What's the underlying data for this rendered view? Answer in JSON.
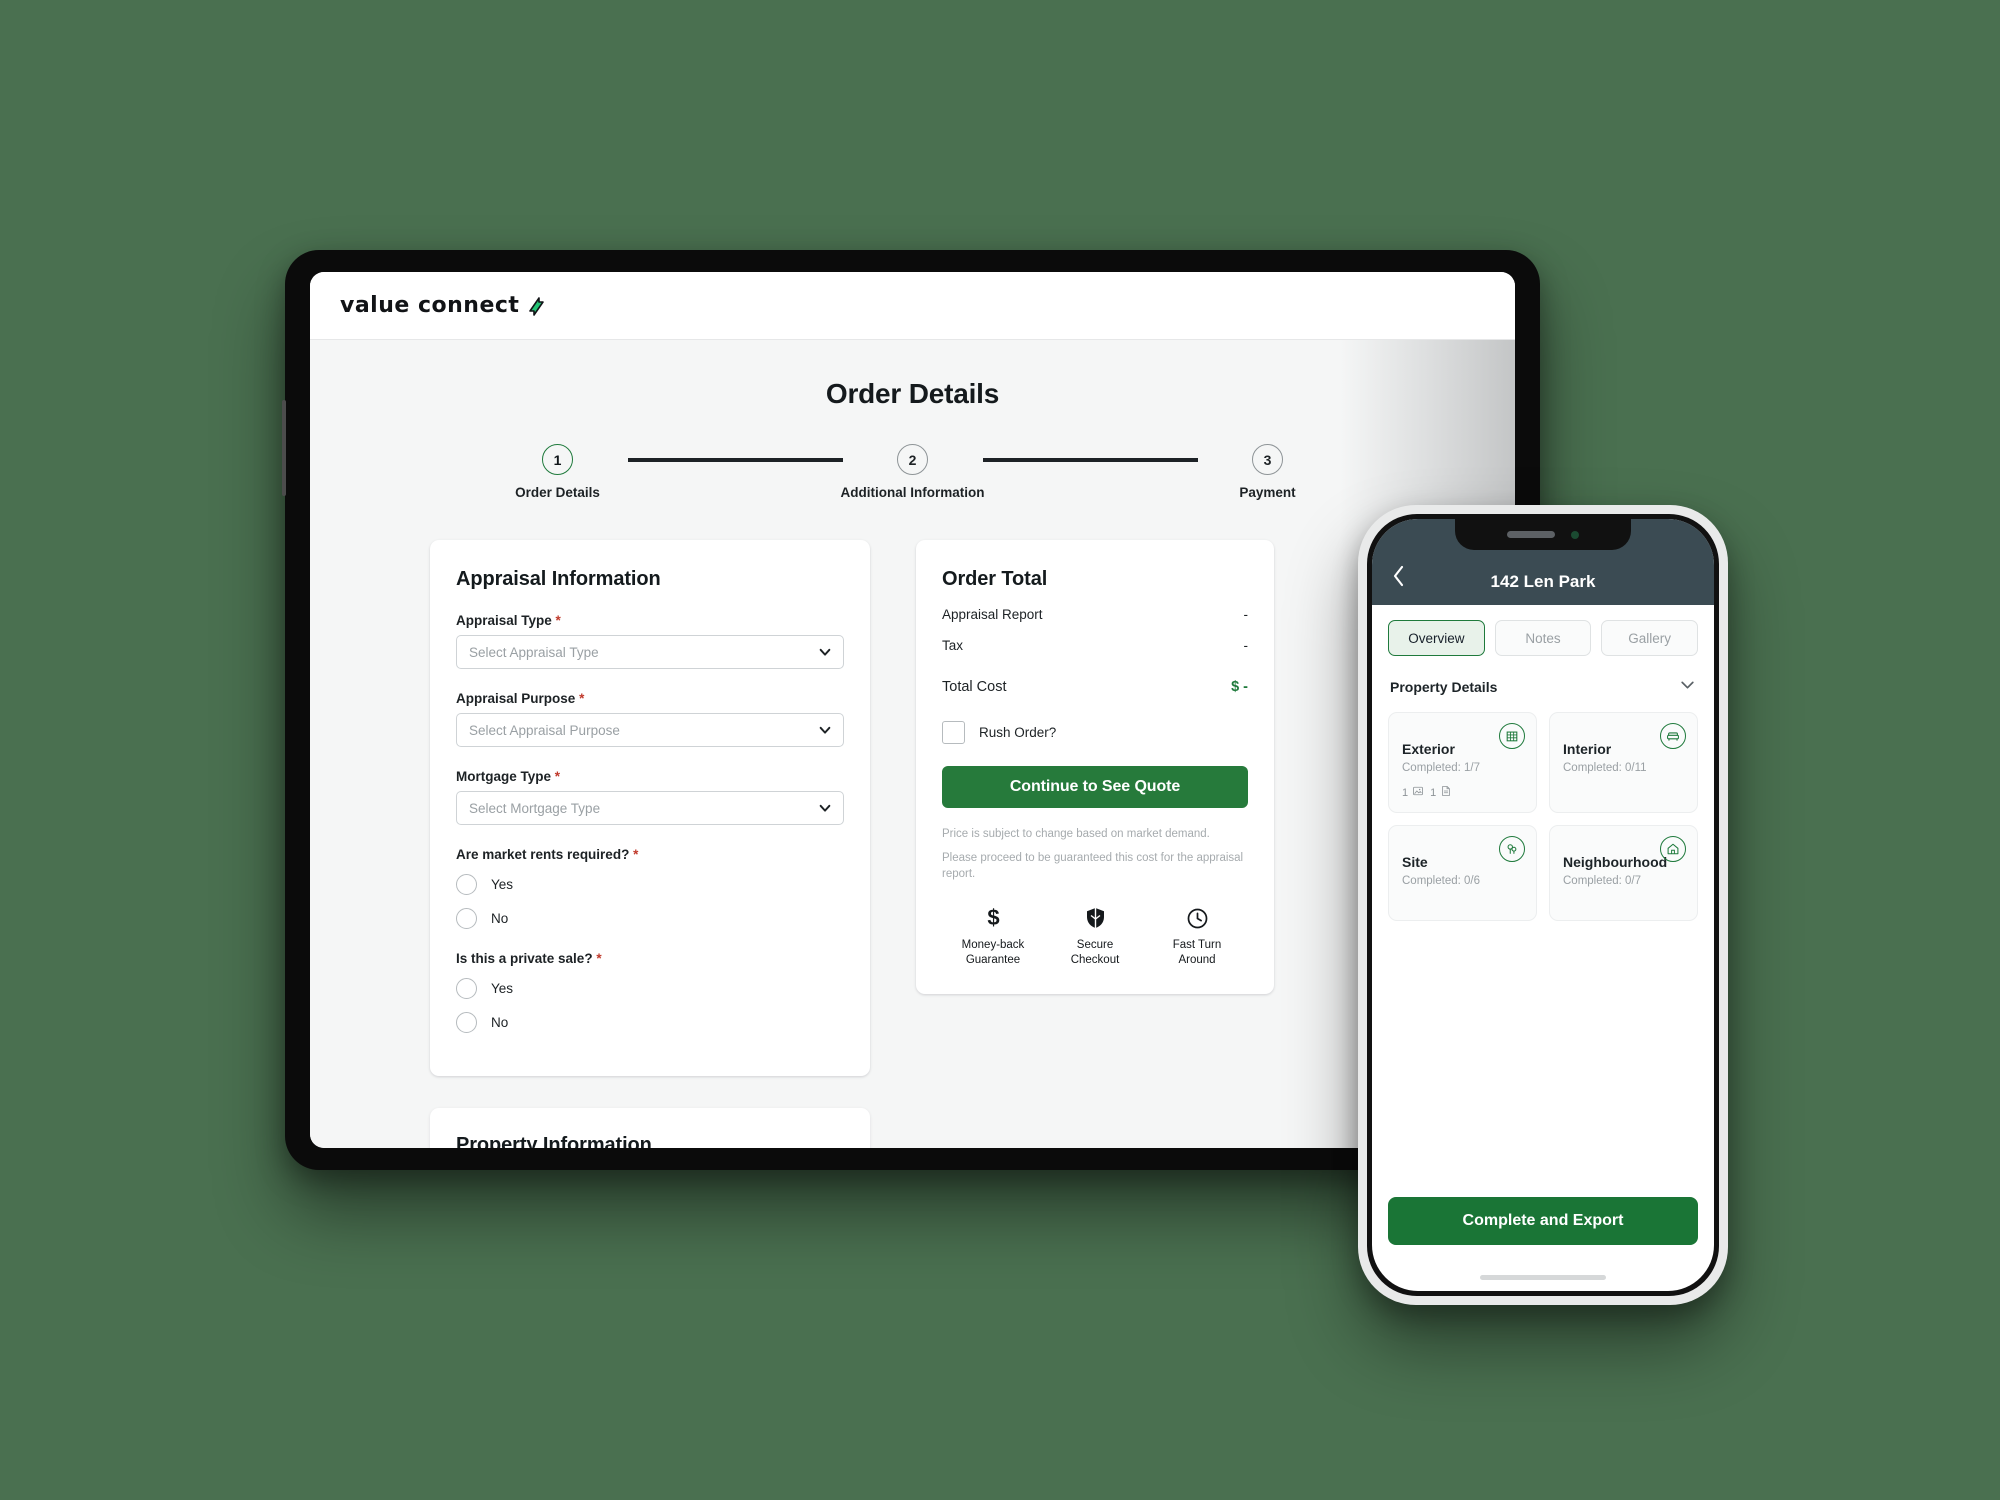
{
  "brand": {
    "name": "value connect",
    "logo_icon": "pen-arrow-icon",
    "accent": "#23c274"
  },
  "colors": {
    "background": "#4a7050",
    "primary_green": "#267a3b",
    "phone_header": "#3b4b53",
    "required_red": "#c0392b"
  },
  "tablet": {
    "page_title": "Order Details",
    "stepper": {
      "steps": [
        {
          "number": "1",
          "label": "Order Details",
          "active": true
        },
        {
          "number": "2",
          "label": "Additional Information",
          "active": false
        },
        {
          "number": "3",
          "label": "Payment",
          "active": false
        }
      ]
    },
    "appraisal_card": {
      "heading": "Appraisal Information",
      "fields": [
        {
          "label": "Appraisal Type",
          "required": "*",
          "placeholder": "Select Appraisal Type",
          "value": ""
        },
        {
          "label": "Appraisal Purpose",
          "required": "*",
          "placeholder": "Select Appraisal Purpose",
          "value": ""
        },
        {
          "label": "Mortgage Type",
          "required": "*",
          "placeholder": "Select Mortgage Type",
          "value": ""
        }
      ],
      "questions": [
        {
          "label": "Are market rents required?",
          "required": "*",
          "options": [
            {
              "label": "Yes",
              "selected": false
            },
            {
              "label": "No",
              "selected": false
            }
          ]
        },
        {
          "label": "Is this a private sale?",
          "required": "*",
          "options": [
            {
              "label": "Yes",
              "selected": false
            },
            {
              "label": "No",
              "selected": false
            }
          ]
        }
      ]
    },
    "order_card": {
      "heading": "Order Total",
      "lines": [
        {
          "key": "Appraisal Report",
          "value": "-"
        },
        {
          "key": "Tax",
          "value": "-"
        }
      ],
      "total_key": "Total Cost",
      "total_value": "$ -",
      "rush_label": "Rush Order?",
      "rush_checked": false,
      "cta_label": "Continue to See Quote",
      "disclaimer_line1": "Price is subject to change based on market demand.",
      "disclaimer_line2": "Please proceed to be guaranteed this cost for the appraisal report.",
      "trust": [
        {
          "icon": "dollar-icon",
          "line1": "Money-back",
          "line2": "Guarantee"
        },
        {
          "icon": "shield-icon",
          "line1": "Secure",
          "line2": "Checkout"
        },
        {
          "icon": "clock-icon",
          "line1": "Fast Turn",
          "line2": "Around"
        }
      ]
    },
    "property_card": {
      "heading": "Property Information"
    }
  },
  "phone": {
    "back_icon": "chevron-left-icon",
    "title": "142 Len Park",
    "tabs": [
      {
        "label": "Overview",
        "active": true
      },
      {
        "label": "Notes",
        "active": false
      },
      {
        "label": "Gallery",
        "active": false
      }
    ],
    "section_label": "Property Details",
    "section_chevron": "chevron-down-icon",
    "tiles": [
      {
        "title": "Exterior",
        "subtitle": "Completed: 1/7",
        "icon": "building-grid-icon",
        "meta": [
          {
            "count": "1",
            "icon": "image-icon"
          },
          {
            "count": "1",
            "icon": "document-icon"
          }
        ]
      },
      {
        "title": "Interior",
        "subtitle": "Completed: 0/11",
        "icon": "sofa-icon",
        "meta": []
      },
      {
        "title": "Site",
        "subtitle": "Completed: 0/6",
        "icon": "tree-icon",
        "meta": []
      },
      {
        "title": "Neighbourhood",
        "subtitle": "Completed: 0/7",
        "icon": "house-icon",
        "meta": []
      }
    ],
    "cta_label": "Complete and Export"
  }
}
